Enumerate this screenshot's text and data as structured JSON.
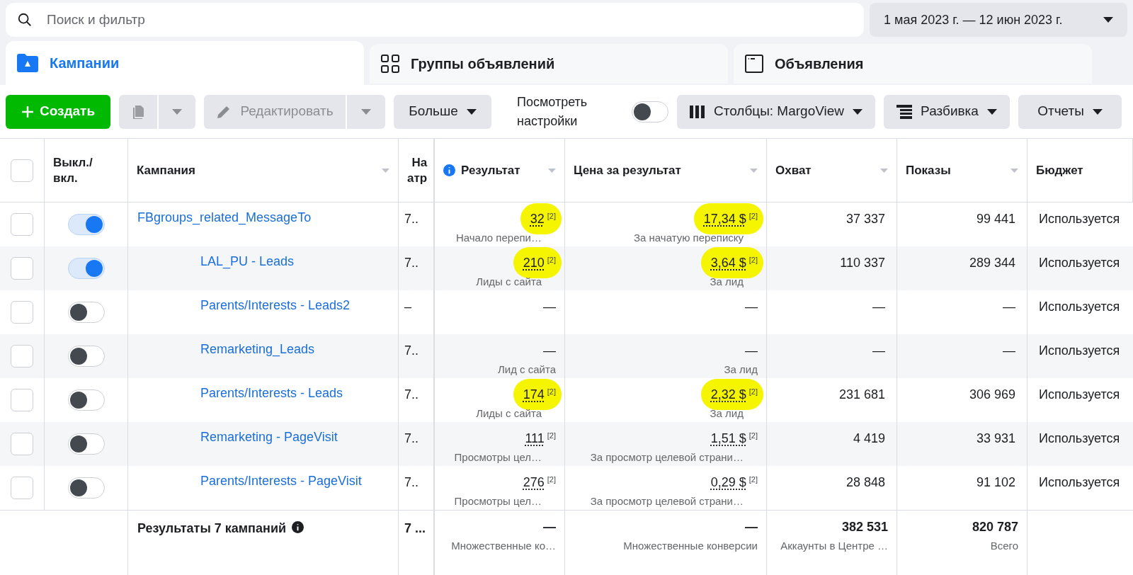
{
  "search": {
    "placeholder": "Поиск и фильтр"
  },
  "date_range": "1 мая 2023 г. — 12 июн 2023 г.",
  "tabs": [
    {
      "label": "Кампании",
      "selected": true
    },
    {
      "label": "Группы объявлений",
      "selected": false
    },
    {
      "label": "Объявления",
      "selected": false
    }
  ],
  "toolbar": {
    "create": "Создать",
    "edit": "Редактировать",
    "more": "Больше",
    "view_settings": {
      "label": "Посмотреть настройки",
      "on": false
    },
    "columns": "Столбцы: MargoView",
    "breakdown": "Разбивка",
    "reports": "Отчеты"
  },
  "table": {
    "select_all": {
      "checked": false
    },
    "columns": [
      "Выкл./ вкл.",
      "Кампания",
      "На атр",
      "Результат",
      "Цена за результат",
      "Охват",
      "Показы",
      "Бюджет"
    ],
    "rows": [
      {
        "selected": false,
        "on": true,
        "name": "FBgroups_related_MessageTo",
        "indented": false,
        "column_3": "7..",
        "result": {
          "value": "32",
          "note": "[2]",
          "sub": "Начало перепи…",
          "highlighted": true
        },
        "cost": {
          "value": "17,34 $",
          "note": "[2]",
          "sub": "За начатую переписку",
          "highlighted": true
        },
        "reach": "37 337",
        "impressions": "99 441",
        "budget": "Используется"
      },
      {
        "selected": false,
        "on": true,
        "name": "LAL_PU - Leads",
        "indented": true,
        "column_3": "7..",
        "result": {
          "value": "210",
          "note": "[2]",
          "sub": "Лиды с сайта",
          "highlighted": true
        },
        "cost": {
          "value": "3,64 $",
          "note": "[2]",
          "sub": "За лид",
          "highlighted": true
        },
        "reach": "110 337",
        "impressions": "289 344",
        "budget": "Используется"
      },
      {
        "selected": false,
        "on": false,
        "name": "Parents/Interests - Leads2",
        "indented": true,
        "column_3": "–",
        "result": {
          "value": "—"
        },
        "cost": {
          "value": "—"
        },
        "reach": "—",
        "impressions": "—",
        "budget": "Используется"
      },
      {
        "selected": false,
        "on": false,
        "name": "Remarketing_Leads",
        "indented": true,
        "column_3": "7..",
        "result": {
          "value": "—",
          "sub": "Лид с сайта"
        },
        "cost": {
          "value": "—",
          "sub": "За лид"
        },
        "reach": "—",
        "impressions": "—",
        "budget": "Используется"
      },
      {
        "selected": false,
        "on": false,
        "name": "Parents/Interests - Leads",
        "indented": true,
        "column_3": "7..",
        "result": {
          "value": "174",
          "note": "[2]",
          "sub": "Лиды с сайта",
          "highlighted": true
        },
        "cost": {
          "value": "2,32 $",
          "note": "[2]",
          "sub": "За лид",
          "highlighted": true
        },
        "reach": "231 681",
        "impressions": "306 969",
        "budget": "Используется"
      },
      {
        "selected": false,
        "on": false,
        "name": "Remarketing - PageVisit",
        "indented": true,
        "column_3": "7..",
        "result": {
          "value": "111",
          "note": "[2]",
          "sub": "Просмотры цел…"
        },
        "cost": {
          "value": "1,51 $",
          "note": "[2]",
          "sub": "За просмотр целевой страни…"
        },
        "reach": "4 419",
        "impressions": "33 931",
        "budget": "Используется"
      },
      {
        "selected": false,
        "on": false,
        "name": "Parents/Interests - PageVisit",
        "indented": true,
        "column_3": "7..",
        "result": {
          "value": "276",
          "note": "[2]",
          "sub": "Просмотры цел…"
        },
        "cost": {
          "value": "0,29 $",
          "note": "[2]",
          "sub": "За просмотр целевой страни…"
        },
        "reach": "28 848",
        "impressions": "91 102",
        "budget": "Используется"
      }
    ],
    "footer": {
      "label": "Результаты 7 кампаний",
      "column_3": "7 ...",
      "result": {
        "value": "—",
        "sub": "Множественные ко…"
      },
      "cost": {
        "value": "—",
        "sub": "Множественные конверсии"
      },
      "reach": {
        "value": "382 531",
        "sub": "Аккаунты в Центре …"
      },
      "impressions": {
        "value": "820 787",
        "sub": "Всего"
      }
    }
  }
}
